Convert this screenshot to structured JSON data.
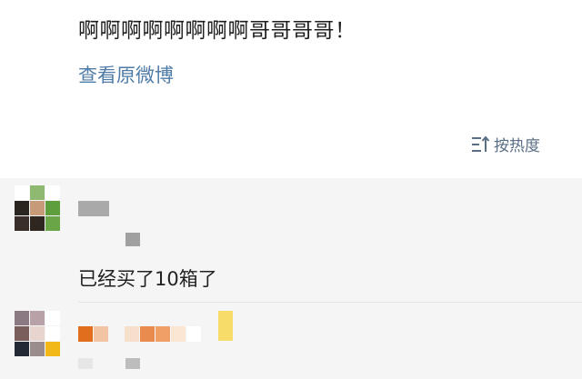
{
  "post": {
    "text": "啊啊啊啊啊啊啊啊哥哥哥哥！",
    "view_original_label": "查看原微博"
  },
  "sort": {
    "label": "按热度",
    "icon": "sort-icon"
  },
  "comments": [
    {
      "body": "已经买了10箱了",
      "username_redacted": true,
      "avatar_redacted": true
    },
    {
      "username_redacted": true,
      "avatar_redacted": true
    }
  ],
  "colors": {
    "link": "#4f7ca6",
    "sort_text": "#5a6f86",
    "comment_bg": "#f5f5f5",
    "text": "#1f1f1f"
  }
}
